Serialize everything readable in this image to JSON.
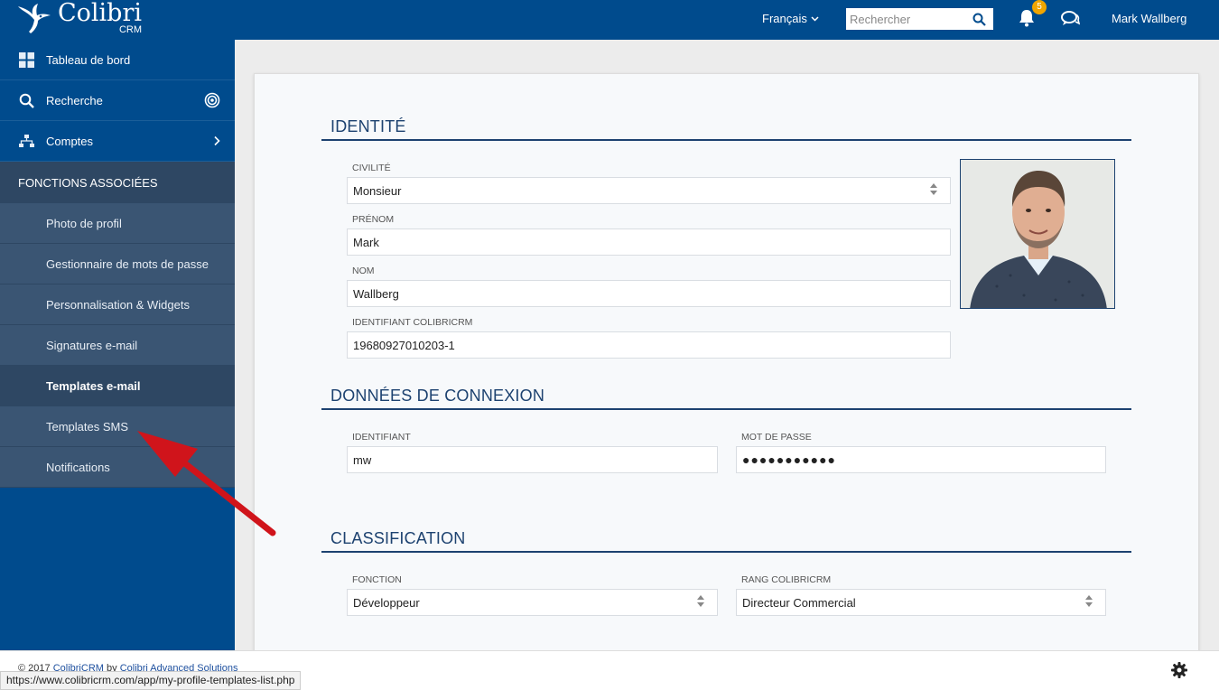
{
  "header": {
    "brand_name": "Colibri",
    "brand_sub": "CRM",
    "language": "Français",
    "search_placeholder": "Rechercher",
    "notifications_count": "5",
    "user_name": "Mark Wallberg"
  },
  "sidebar": {
    "items": [
      {
        "label": "Tableau de bord",
        "icon": "grid-icon"
      },
      {
        "label": "Recherche",
        "icon": "search-icon"
      },
      {
        "label": "Comptes",
        "icon": "org-icon"
      }
    ],
    "section_title": "FONCTIONS ASSOCIÉES",
    "sub_items": [
      {
        "label": "Photo de profil"
      },
      {
        "label": "Gestionnaire de mots de passe"
      },
      {
        "label": "Personnalisation & Widgets"
      },
      {
        "label": "Signatures e-mail"
      },
      {
        "label": "Templates e-mail"
      },
      {
        "label": "Templates SMS"
      },
      {
        "label": "Notifications"
      }
    ],
    "active_sub_item": "Templates e-mail"
  },
  "identity": {
    "title": "IDENTITÉ",
    "civilite_label": "CIVILITÉ",
    "civilite_value": "Monsieur",
    "prenom_label": "PRÉNOM",
    "prenom_value": "Mark",
    "nom_label": "NOM",
    "nom_value": "Wallberg",
    "identifiant_label": "IDENTIFIANT COLIBRICRM",
    "identifiant_value": "19680927010203-1"
  },
  "connexion": {
    "title": "DONNÉES DE CONNEXION",
    "login_label": "IDENTIFIANT",
    "login_value": "mw",
    "password_label": "MOT DE PASSE",
    "password_value": "●●●●●●●●●●●"
  },
  "classification": {
    "title": "CLASSIFICATION",
    "fonction_label": "FONCTION",
    "fonction_value": "Développeur",
    "rang_label": "RANG COLIBRICRM",
    "rang_value": "Directeur Commercial"
  },
  "footer": {
    "copyright_prefix": "© 2017",
    "copyright_link1": "ColibriCRM",
    "copyright_by": "by",
    "copyright_link2": "Colibri Advanced Solutions",
    "status_url": "https://www.colibricrm.com/app/my-profile-templates-list.php"
  },
  "colors": {
    "brand_blue": "#004b8d",
    "section_dark": "#2e4763",
    "sub_item": "#3a5573",
    "accent": "#1d4270",
    "badge": "#f0a500",
    "annotation_arrow": "#d0141b"
  }
}
